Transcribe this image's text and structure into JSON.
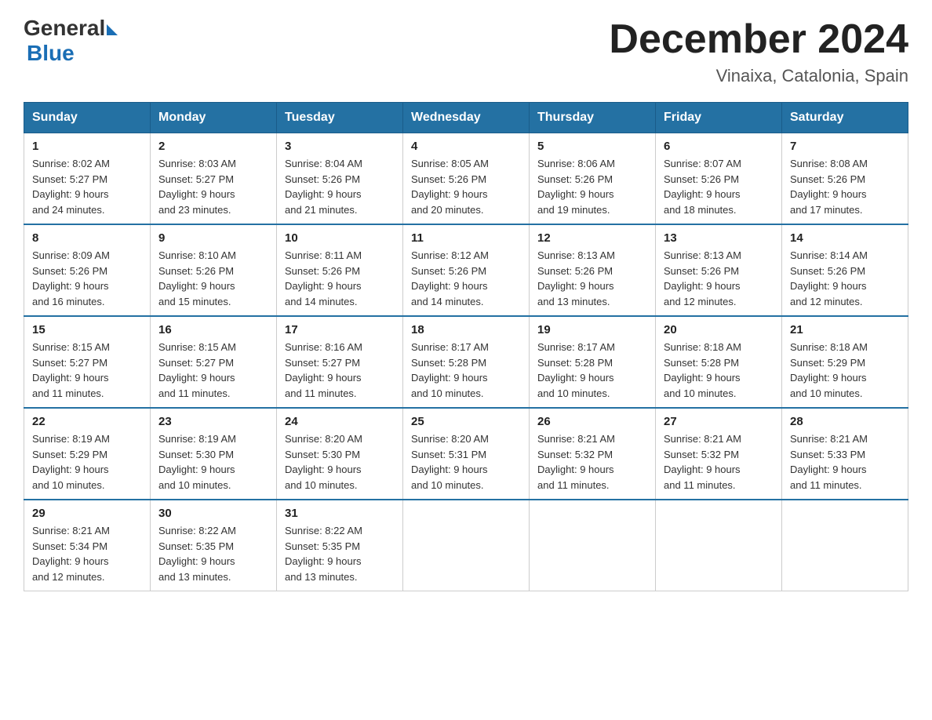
{
  "logo": {
    "general": "General",
    "blue": "Blue"
  },
  "header": {
    "month_year": "December 2024",
    "location": "Vinaixa, Catalonia, Spain"
  },
  "days_of_week": [
    "Sunday",
    "Monday",
    "Tuesday",
    "Wednesday",
    "Thursday",
    "Friday",
    "Saturday"
  ],
  "weeks": [
    [
      {
        "day": "1",
        "sunrise": "8:02 AM",
        "sunset": "5:27 PM",
        "daylight": "9 hours and 24 minutes."
      },
      {
        "day": "2",
        "sunrise": "8:03 AM",
        "sunset": "5:27 PM",
        "daylight": "9 hours and 23 minutes."
      },
      {
        "day": "3",
        "sunrise": "8:04 AM",
        "sunset": "5:26 PM",
        "daylight": "9 hours and 21 minutes."
      },
      {
        "day": "4",
        "sunrise": "8:05 AM",
        "sunset": "5:26 PM",
        "daylight": "9 hours and 20 minutes."
      },
      {
        "day": "5",
        "sunrise": "8:06 AM",
        "sunset": "5:26 PM",
        "daylight": "9 hours and 19 minutes."
      },
      {
        "day": "6",
        "sunrise": "8:07 AM",
        "sunset": "5:26 PM",
        "daylight": "9 hours and 18 minutes."
      },
      {
        "day": "7",
        "sunrise": "8:08 AM",
        "sunset": "5:26 PM",
        "daylight": "9 hours and 17 minutes."
      }
    ],
    [
      {
        "day": "8",
        "sunrise": "8:09 AM",
        "sunset": "5:26 PM",
        "daylight": "9 hours and 16 minutes."
      },
      {
        "day": "9",
        "sunrise": "8:10 AM",
        "sunset": "5:26 PM",
        "daylight": "9 hours and 15 minutes."
      },
      {
        "day": "10",
        "sunrise": "8:11 AM",
        "sunset": "5:26 PM",
        "daylight": "9 hours and 14 minutes."
      },
      {
        "day": "11",
        "sunrise": "8:12 AM",
        "sunset": "5:26 PM",
        "daylight": "9 hours and 14 minutes."
      },
      {
        "day": "12",
        "sunrise": "8:13 AM",
        "sunset": "5:26 PM",
        "daylight": "9 hours and 13 minutes."
      },
      {
        "day": "13",
        "sunrise": "8:13 AM",
        "sunset": "5:26 PM",
        "daylight": "9 hours and 12 minutes."
      },
      {
        "day": "14",
        "sunrise": "8:14 AM",
        "sunset": "5:26 PM",
        "daylight": "9 hours and 12 minutes."
      }
    ],
    [
      {
        "day": "15",
        "sunrise": "8:15 AM",
        "sunset": "5:27 PM",
        "daylight": "9 hours and 11 minutes."
      },
      {
        "day": "16",
        "sunrise": "8:15 AM",
        "sunset": "5:27 PM",
        "daylight": "9 hours and 11 minutes."
      },
      {
        "day": "17",
        "sunrise": "8:16 AM",
        "sunset": "5:27 PM",
        "daylight": "9 hours and 11 minutes."
      },
      {
        "day": "18",
        "sunrise": "8:17 AM",
        "sunset": "5:28 PM",
        "daylight": "9 hours and 10 minutes."
      },
      {
        "day": "19",
        "sunrise": "8:17 AM",
        "sunset": "5:28 PM",
        "daylight": "9 hours and 10 minutes."
      },
      {
        "day": "20",
        "sunrise": "8:18 AM",
        "sunset": "5:28 PM",
        "daylight": "9 hours and 10 minutes."
      },
      {
        "day": "21",
        "sunrise": "8:18 AM",
        "sunset": "5:29 PM",
        "daylight": "9 hours and 10 minutes."
      }
    ],
    [
      {
        "day": "22",
        "sunrise": "8:19 AM",
        "sunset": "5:29 PM",
        "daylight": "9 hours and 10 minutes."
      },
      {
        "day": "23",
        "sunrise": "8:19 AM",
        "sunset": "5:30 PM",
        "daylight": "9 hours and 10 minutes."
      },
      {
        "day": "24",
        "sunrise": "8:20 AM",
        "sunset": "5:30 PM",
        "daylight": "9 hours and 10 minutes."
      },
      {
        "day": "25",
        "sunrise": "8:20 AM",
        "sunset": "5:31 PM",
        "daylight": "9 hours and 10 minutes."
      },
      {
        "day": "26",
        "sunrise": "8:21 AM",
        "sunset": "5:32 PM",
        "daylight": "9 hours and 11 minutes."
      },
      {
        "day": "27",
        "sunrise": "8:21 AM",
        "sunset": "5:32 PM",
        "daylight": "9 hours and 11 minutes."
      },
      {
        "day": "28",
        "sunrise": "8:21 AM",
        "sunset": "5:33 PM",
        "daylight": "9 hours and 11 minutes."
      }
    ],
    [
      {
        "day": "29",
        "sunrise": "8:21 AM",
        "sunset": "5:34 PM",
        "daylight": "9 hours and 12 minutes."
      },
      {
        "day": "30",
        "sunrise": "8:22 AM",
        "sunset": "5:35 PM",
        "daylight": "9 hours and 13 minutes."
      },
      {
        "day": "31",
        "sunrise": "8:22 AM",
        "sunset": "5:35 PM",
        "daylight": "9 hours and 13 minutes."
      },
      null,
      null,
      null,
      null
    ]
  ],
  "labels": {
    "sunrise": "Sunrise:",
    "sunset": "Sunset:",
    "daylight": "Daylight:"
  }
}
